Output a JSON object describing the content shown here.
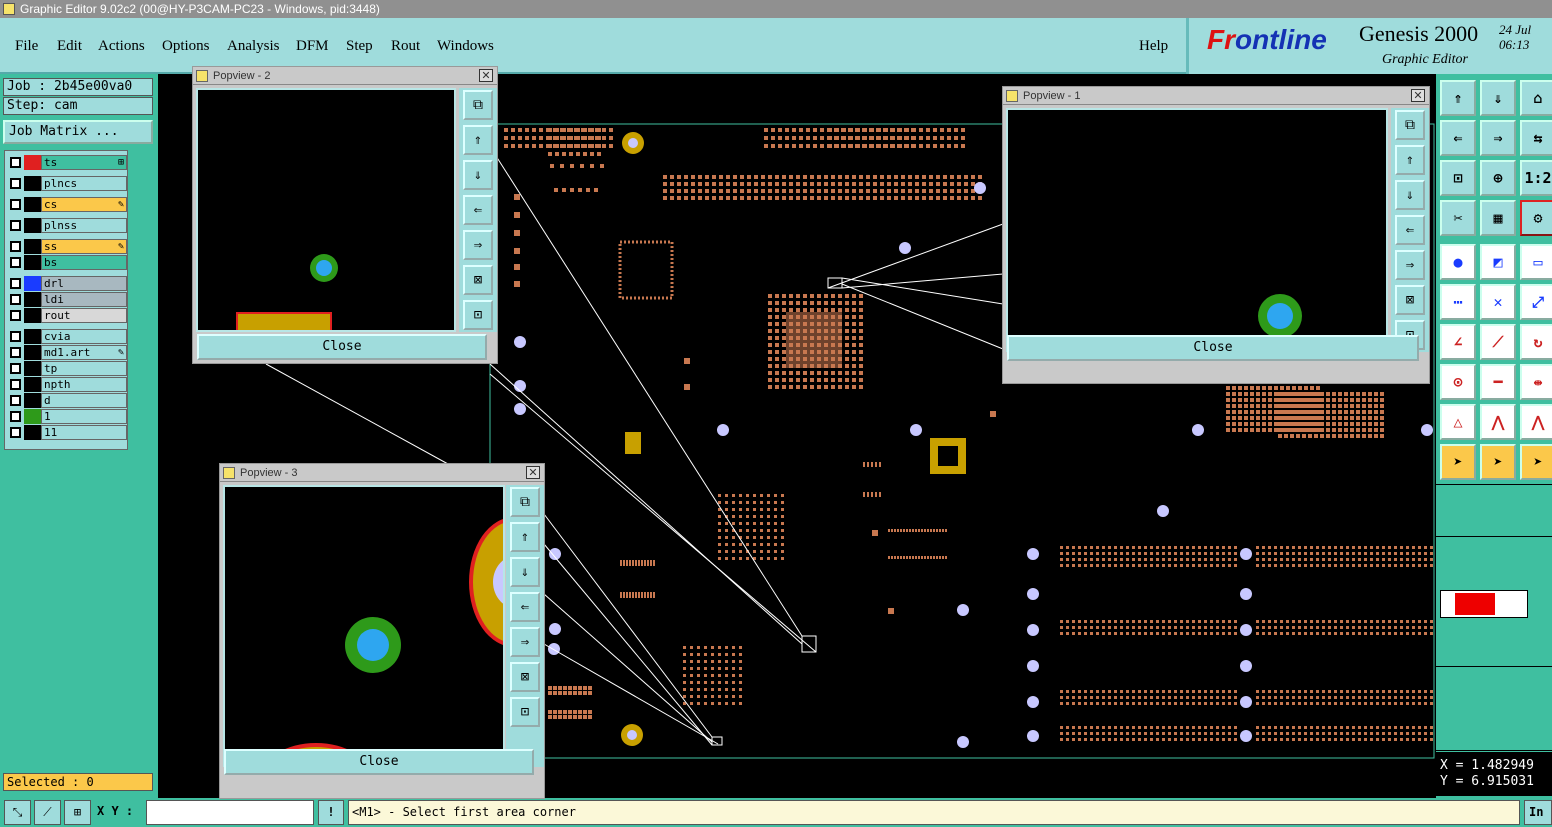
{
  "window": {
    "title": "Graphic Editor 9.02c2 (00@HY-P3CAM-PC23 - Windows, pid:3448)"
  },
  "menu": [
    "File",
    "Edit",
    "Actions",
    "Options",
    "Analysis",
    "DFM",
    "Step",
    "Rout",
    "Windows"
  ],
  "help": "Help",
  "brand": {
    "logo_a": "Fr",
    "logo_o": "o",
    "logo_b": "ntline",
    "product": "Genesis 2000",
    "subtitle": "Graphic Editor",
    "date": "24 Jul",
    "time": "06:13"
  },
  "job": {
    "job_label": "Job : 2b45e00va0",
    "step_label": "Step: cam",
    "matrix_button": "Job Matrix ..."
  },
  "layers": [
    {
      "name": "ts",
      "color": "#e02020",
      "bg": "#3fbfa0",
      "flag": "⊞"
    },
    {
      "name": "plncs",
      "color": "#000000",
      "bg": "#9fdcdc",
      "flag": ""
    },
    {
      "name": "cs",
      "color": "#000000",
      "bg": "#fbc84a",
      "flag": "✎"
    },
    {
      "name": "plnss",
      "color": "#000000",
      "bg": "#9fdcdc",
      "flag": ""
    },
    {
      "name": "ss",
      "color": "#000000",
      "bg": "#fbc84a",
      "flag": "✎"
    },
    {
      "name": "bs",
      "color": "#000000",
      "bg": "#3fbfa0",
      "flag": ""
    },
    {
      "name": "drl",
      "color": "#1a3cff",
      "bg": "#a8b8c0",
      "flag": ""
    },
    {
      "name": "ldi",
      "color": "#000000",
      "bg": "#a8b8c0",
      "flag": ""
    },
    {
      "name": "rout",
      "color": "#000000",
      "bg": "#d8d8d8",
      "flag": ""
    },
    {
      "name": "cvia",
      "color": "#000000",
      "bg": "#9fdcdc",
      "flag": ""
    },
    {
      "name": "md1.art",
      "color": "#000000",
      "bg": "#9fdcdc",
      "flag": "✎"
    },
    {
      "name": "tp",
      "color": "#000000",
      "bg": "#9fdcdc",
      "flag": ""
    },
    {
      "name": "npth",
      "color": "#000000",
      "bg": "#9fdcdc",
      "flag": ""
    },
    {
      "name": "d",
      "color": "#000000",
      "bg": "#9fdcdc",
      "flag": ""
    },
    {
      "name": "1",
      "color": "#2e9a1a",
      "bg": "#9fdcdc",
      "flag": ""
    },
    {
      "name": "11",
      "color": "#000000",
      "bg": "#9fdcdc",
      "flag": ""
    }
  ],
  "selected": "Selected : 0",
  "popviews": [
    {
      "title": "Popview - 2",
      "close": "Close"
    },
    {
      "title": "Popview - 1",
      "close": "Close"
    },
    {
      "title": "Popview - 3",
      "close": "Close"
    }
  ],
  "popview_tool_icons": [
    "zoom-window-icon",
    "pan-up-icon",
    "pan-down-icon",
    "pan-left-icon",
    "pan-right-icon",
    "zoom-in-icon",
    "zoom-out-icon"
  ],
  "coords": {
    "x": "X = 1.482949",
    "y": "Y = 6.915031"
  },
  "status": {
    "xy_label": "X Y :",
    "xy_value": "",
    "prompt": "<M1> - Select first area corner",
    "right": "In"
  },
  "colors": {
    "panel": "#3fbfa0",
    "button": "#9fdcdc",
    "pad": "#c87850",
    "via": "#c8c8ff",
    "highlight": "#fbc84a"
  }
}
